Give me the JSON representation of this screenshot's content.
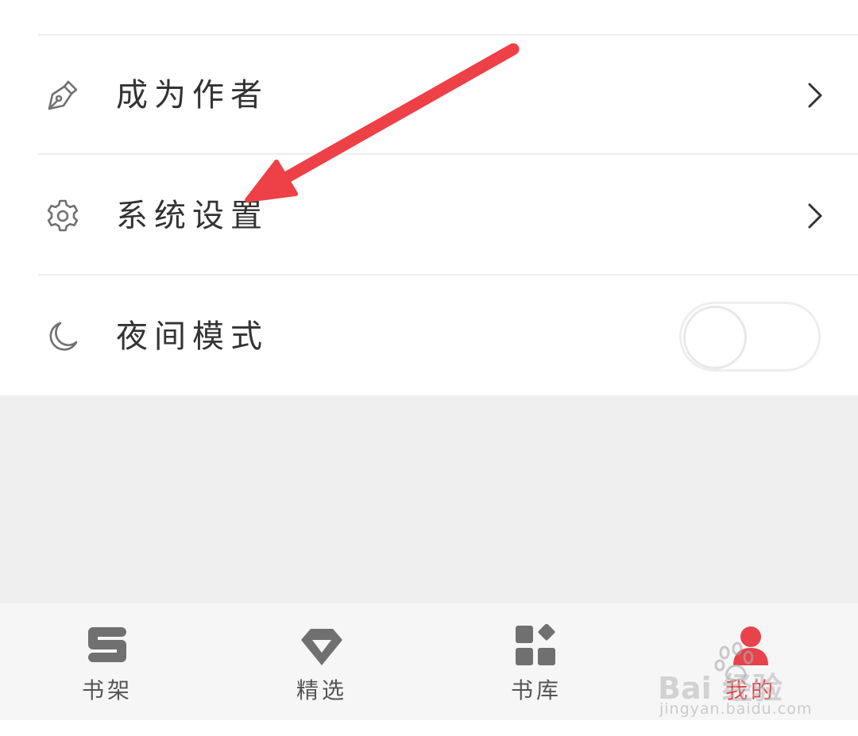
{
  "menu": {
    "items": [
      {
        "label": "成为作者",
        "icon": "pen-nib-icon"
      },
      {
        "label": "系统设置",
        "icon": "gear-icon"
      },
      {
        "label": "夜间模式",
        "icon": "moon-icon",
        "toggle": "off"
      }
    ]
  },
  "tabs": [
    {
      "label": "书架",
      "icon": "bookshelf-s-icon",
      "active": false
    },
    {
      "label": "精选",
      "icon": "diamond-icon",
      "active": false
    },
    {
      "label": "书库",
      "icon": "library-grid-icon",
      "active": false
    },
    {
      "label": "我的",
      "icon": "profile-person-icon",
      "active": true
    }
  ],
  "watermark": {
    "logo_text": "Bai 经验",
    "url": "jingyan.baidu.com"
  },
  "colors": {
    "accent": "#e8424b",
    "annotation_arrow": "#ee4047",
    "icon_gray": "#707070",
    "divider": "#eeeeee",
    "background_gray": "#efefef"
  }
}
